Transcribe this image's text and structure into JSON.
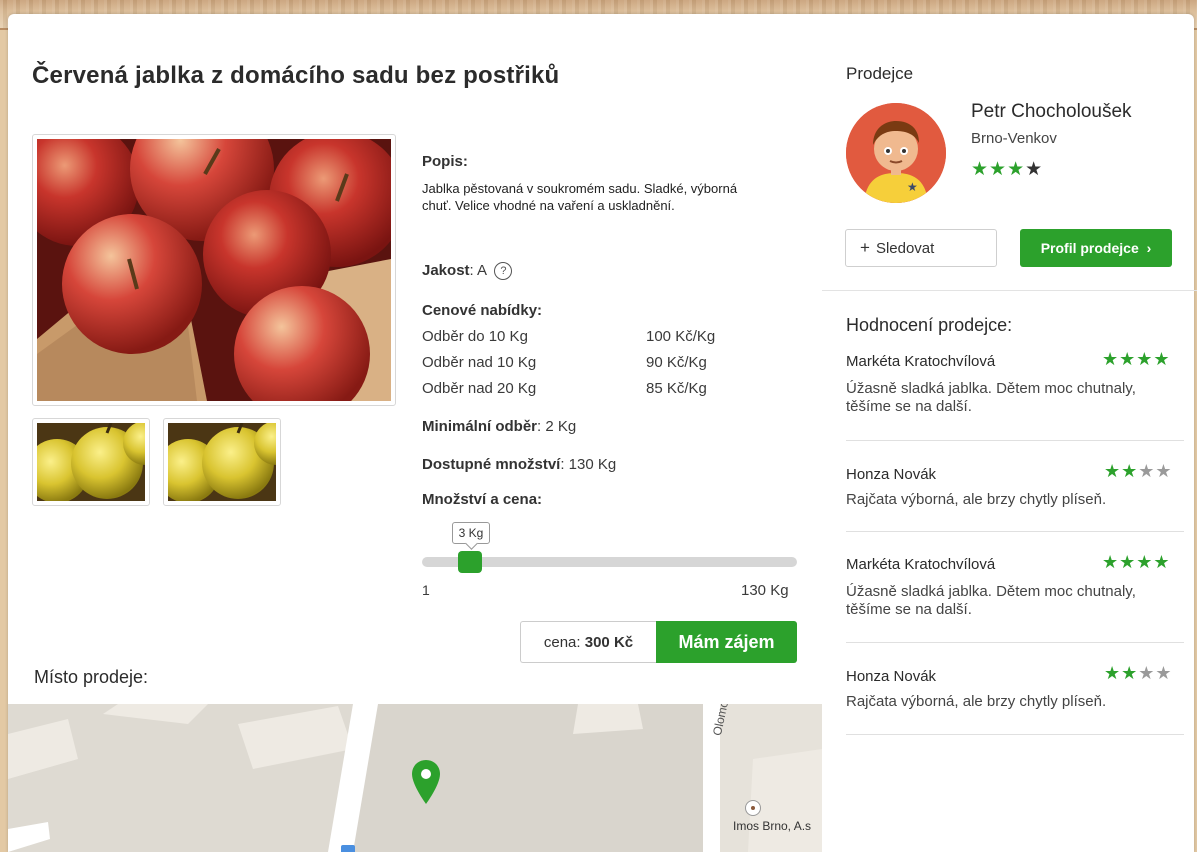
{
  "product": {
    "title": "Červená jablka z domácího sadu bez postřiků",
    "description_label": "Popis:",
    "description": "Jablka pěstovaná v soukromém sadu. Sladké, výborná chuť. Velice vhodné na vaření a uskladnění.",
    "quality_label": "Jakost",
    "quality_value": ": A",
    "quality_help": "?",
    "offers_label": "Cenové nabídky:",
    "offers": [
      {
        "label": "Odběr do 10 Kg",
        "price": "100 Kč/Kg"
      },
      {
        "label": "Odběr nad 10 Kg",
        "price": "90 Kč/Kg"
      },
      {
        "label": "Odběr nad 20 Kg",
        "price": "85 Kč/Kg"
      }
    ],
    "min_order_label": "Minimální odběr",
    "min_order_value": ": 2 Kg",
    "available_label": "Dostupné množství",
    "available_value": ": 130 Kg",
    "qty_label": "Množství a cena:",
    "slider": {
      "value_label": "3 Kg",
      "min_label": "1",
      "max_label": "130 Kg",
      "value": 3,
      "min": 1,
      "max": 130
    },
    "price_prefix": "cena:",
    "price_value": "300 Kč",
    "interest_button": "Mám zájem",
    "place_label": "Místo prodeje:"
  },
  "map": {
    "street_label": "Olomoucká",
    "poi_label": "Imos Brno, A.s"
  },
  "seller": {
    "heading": "Prodejce",
    "name": "Petr Chocholoušek",
    "location": "Brno-Venkov",
    "rating": 3,
    "rating_max": 4,
    "follow_icon": "+",
    "follow_label": "Sledovat",
    "profile_label": "Profil prodejce",
    "profile_chevron": "›"
  },
  "reviews": {
    "heading": "Hodnocení prodejce",
    "heading_colon": ":",
    "items": [
      {
        "name": "Markéta Kratochvílová",
        "rating": 4,
        "text": "Úžasně sladká jablka. Dětem moc chutnaly, těšíme se na další."
      },
      {
        "name": "Honza Novák",
        "rating": 2,
        "text": "Rajčata výborná, ale brzy chytly plíseň."
      },
      {
        "name": "Markéta Kratochvílová",
        "rating": 4,
        "text": "Úžasně sladká jablka. Dětem moc chutnaly, těšíme se na další."
      },
      {
        "name": "Honza Novák",
        "rating": 2,
        "text": "Rajčata výborná, ale brzy chytly plíseň."
      }
    ]
  },
  "colors": {
    "accent": "#2ca12c",
    "star_empty": "#9a9a9a",
    "star_dark": "#333333",
    "map_pin": "#2ca12c"
  },
  "icons": {
    "star": "★",
    "map_pin": "map-pin-icon",
    "poi": "poi-icon",
    "help": "help-circle-icon",
    "plus": "plus-icon",
    "chevron": "chevron-right-icon"
  }
}
